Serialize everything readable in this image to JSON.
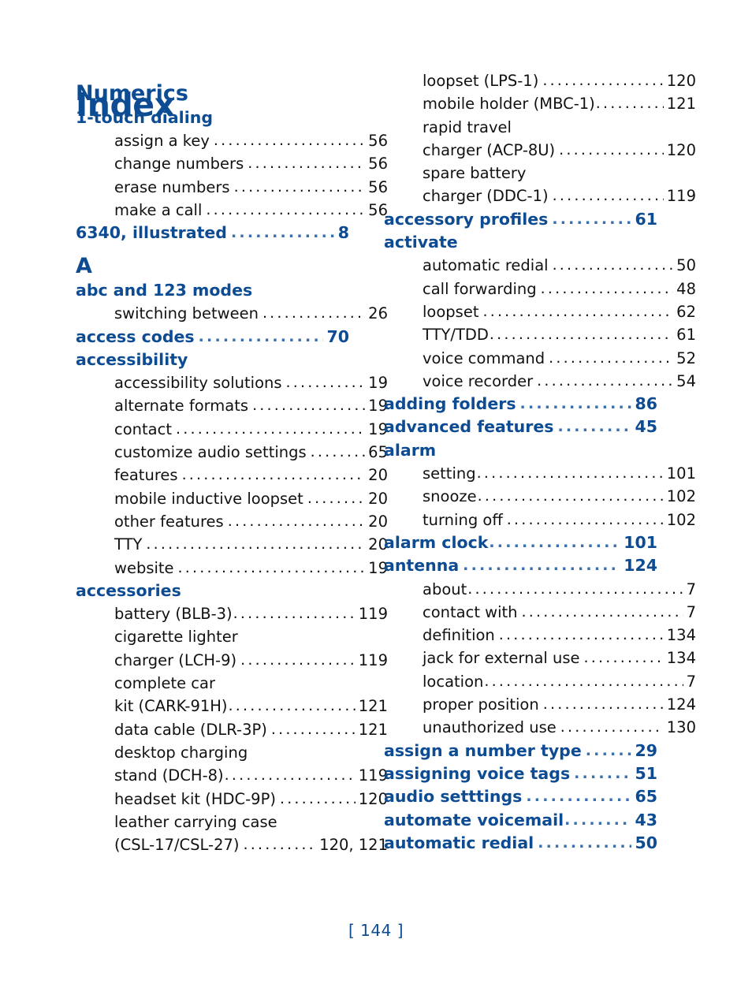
{
  "document": {
    "title": "Index",
    "footer": "[ 144 ]",
    "accent_color": "#0d4c93",
    "body_color": "#111111"
  },
  "columns": [
    {
      "name": "left-column",
      "blocks": [
        {
          "type": "section",
          "label": "Numerics"
        },
        {
          "type": "main",
          "label": "1-touch dialing",
          "page": ""
        },
        {
          "type": "sub",
          "label": "assign a key",
          "page": "56"
        },
        {
          "type": "sub",
          "label": "change numbers",
          "page": "56"
        },
        {
          "type": "sub",
          "label": "erase numbers",
          "page": "56"
        },
        {
          "type": "sub",
          "label": "make a call",
          "page": "56"
        },
        {
          "type": "main",
          "label": "6340, illustrated",
          "page": "8"
        },
        {
          "type": "section",
          "label": "A"
        },
        {
          "type": "main",
          "label": "abc and 123 modes",
          "page": ""
        },
        {
          "type": "sub",
          "label": "switching between",
          "page": "26"
        },
        {
          "type": "main",
          "label": "access codes",
          "page": "70"
        },
        {
          "type": "main",
          "label": "accessibility",
          "page": ""
        },
        {
          "type": "sub",
          "label": "accessibility solutions",
          "page": "19"
        },
        {
          "type": "sub",
          "label": "alternate formats",
          "page": "19"
        },
        {
          "type": "sub",
          "label": "contact",
          "page": "19"
        },
        {
          "type": "sub",
          "label": "customize audio settings",
          "page": "65"
        },
        {
          "type": "sub",
          "label": "features",
          "page": "20"
        },
        {
          "type": "sub",
          "label": "mobile inductive loopset",
          "page": "20"
        },
        {
          "type": "sub",
          "label": "other features",
          "page": "20"
        },
        {
          "type": "sub",
          "label": "TTY",
          "page": "20"
        },
        {
          "type": "sub",
          "label": "website",
          "page": "19"
        },
        {
          "type": "main",
          "label": "accessories",
          "page": ""
        },
        {
          "type": "sub",
          "label": "battery (BLB-3)",
          "page": "119",
          "nogap": true
        },
        {
          "type": "subcont",
          "label": "cigarette lighter"
        },
        {
          "type": "sub",
          "label": "charger (LCH-9)",
          "page": "119"
        },
        {
          "type": "subcont",
          "label": "complete car"
        },
        {
          "type": "sub",
          "label": "kit (CARK-91H)",
          "page": "121",
          "nogap": true
        },
        {
          "type": "sub",
          "label": "data cable (DLR-3P)",
          "page": "121"
        },
        {
          "type": "subcont",
          "label": "desktop charging"
        },
        {
          "type": "sub",
          "label": "stand (DCH-8)",
          "page": "119",
          "nogap": true
        },
        {
          "type": "sub",
          "label": "headset kit (HDC-9P)",
          "page": "120"
        },
        {
          "type": "subcont",
          "label": "leather carrying case"
        },
        {
          "type": "sub",
          "label": "(CSL-17/CSL-27)",
          "page": "120, 121"
        }
      ]
    },
    {
      "name": "right-column",
      "blocks": [
        {
          "type": "sub",
          "label": "loopset (LPS-1)",
          "page": "120"
        },
        {
          "type": "sub",
          "label": "mobile holder (MBC-1)",
          "page": "121",
          "nogap": true
        },
        {
          "type": "subcont",
          "label": "rapid travel"
        },
        {
          "type": "sub",
          "label": "charger (ACP-8U)",
          "page": "120"
        },
        {
          "type": "subcont",
          "label": "spare battery"
        },
        {
          "type": "sub",
          "label": "charger (DDC-1)",
          "page": "119"
        },
        {
          "type": "main",
          "label": "accessory profiles",
          "page": "61"
        },
        {
          "type": "main",
          "label": "activate",
          "page": ""
        },
        {
          "type": "sub",
          "label": "automatic redial",
          "page": "50"
        },
        {
          "type": "sub",
          "label": "call forwarding",
          "page": "48"
        },
        {
          "type": "sub",
          "label": "loopset",
          "page": "62"
        },
        {
          "type": "sub",
          "label": "TTY/TDD",
          "page": "61",
          "nogap": true
        },
        {
          "type": "sub",
          "label": "voice command",
          "page": "52"
        },
        {
          "type": "sub",
          "label": "voice recorder",
          "page": "54"
        },
        {
          "type": "main",
          "label": "adding folders",
          "page": "86"
        },
        {
          "type": "main",
          "label": "advanced features",
          "page": "45"
        },
        {
          "type": "main",
          "label": "alarm",
          "page": ""
        },
        {
          "type": "sub",
          "label": "setting",
          "page": "101",
          "nogap": true
        },
        {
          "type": "sub",
          "label": "snooze",
          "page": "102",
          "nogap": true
        },
        {
          "type": "sub",
          "label": "turning off",
          "page": "102"
        },
        {
          "type": "main",
          "label": "alarm clock",
          "page": "101",
          "nogap": true
        },
        {
          "type": "main",
          "label": "antenna",
          "page": "124"
        },
        {
          "type": "sub",
          "label": "about",
          "page": "7",
          "nogap": true
        },
        {
          "type": "sub",
          "label": "contact with",
          "page": "7"
        },
        {
          "type": "sub",
          "label": "definition",
          "page": "134"
        },
        {
          "type": "sub",
          "label": "jack for external use",
          "page": "134"
        },
        {
          "type": "sub",
          "label": "location",
          "page": "7",
          "nogap": true
        },
        {
          "type": "sub",
          "label": "proper position",
          "page": "124"
        },
        {
          "type": "sub",
          "label": "unauthorized use",
          "page": "130"
        },
        {
          "type": "main",
          "label": "assign a number type",
          "page": "29"
        },
        {
          "type": "main",
          "label": "assigning voice tags",
          "page": "51"
        },
        {
          "type": "main",
          "label": "audio setttings",
          "page": "65"
        },
        {
          "type": "main",
          "label": "automate voicemail",
          "page": "43",
          "nogap": true
        },
        {
          "type": "main",
          "label": "automatic redial",
          "page": "50"
        }
      ]
    }
  ]
}
